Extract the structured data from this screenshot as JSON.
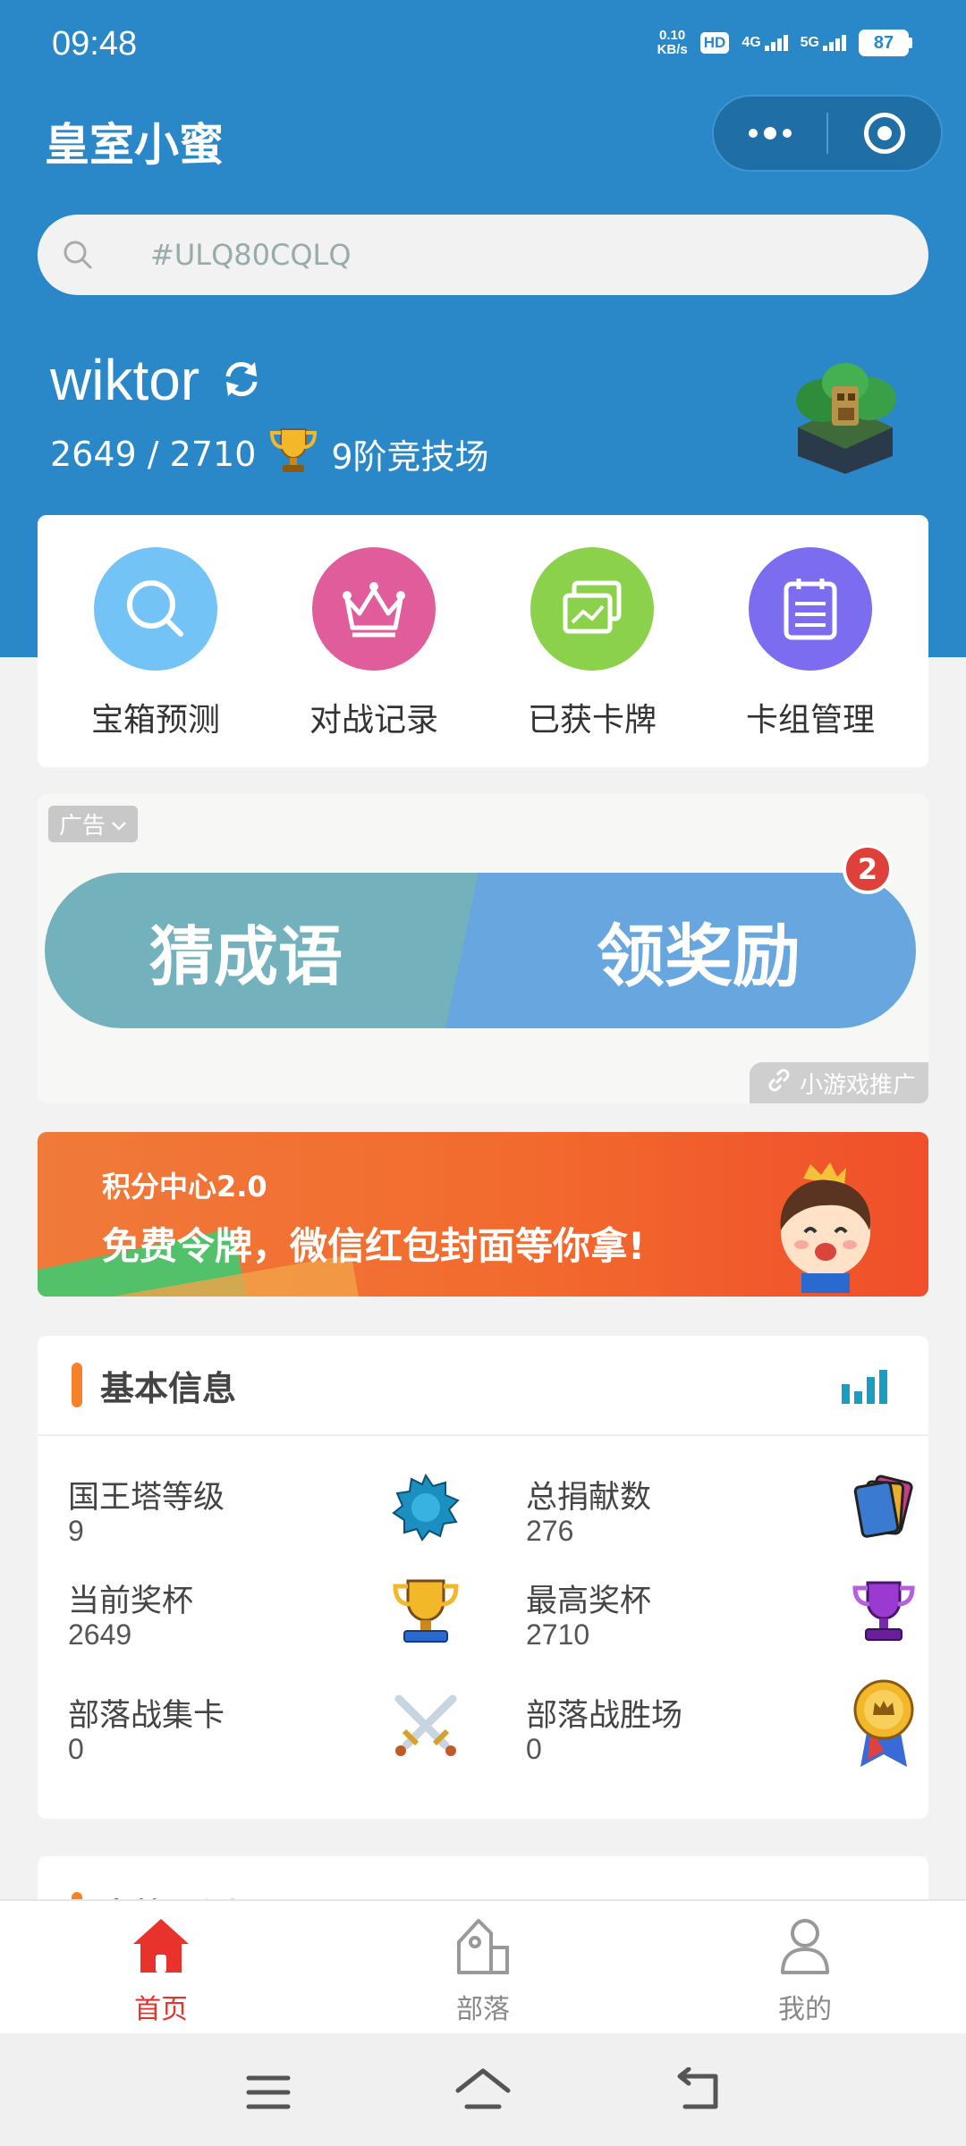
{
  "status_bar": {
    "time": "09:48",
    "speed_value": "0.10",
    "speed_unit": "KB/s",
    "hd_label": "HD",
    "net1_label": "4G",
    "net2_label": "5G",
    "battery": "87"
  },
  "header": {
    "title": "皇室小蜜"
  },
  "search": {
    "placeholder": "#ULQ80CQLQ"
  },
  "player": {
    "name": "wiktor",
    "trophies": "2649 / 2710",
    "arena": "9阶竞技场"
  },
  "quick_actions": [
    {
      "label": "宝箱预测",
      "color": "#73c3f6"
    },
    {
      "label": "对战记录",
      "color": "#e05c9a"
    },
    {
      "label": "已获卡牌",
      "color": "#8bd14c"
    },
    {
      "label": "卡组管理",
      "color": "#7b6cf0"
    }
  ],
  "ad": {
    "tag": "广告",
    "left_text": "猜成语",
    "right_text": "领奖励",
    "badge": "2",
    "promo": "小游戏推广"
  },
  "banner": {
    "title": "积分中心2.0",
    "subtitle": "免费令牌，微信红包封面等你拿!"
  },
  "basic_info": {
    "title": "基本信息",
    "stats": [
      {
        "label": "国王塔等级",
        "value": "9",
        "icon": "king-level-icon"
      },
      {
        "label": "总捐献数",
        "value": "276",
        "icon": "cards-icon"
      },
      {
        "label": "当前奖杯",
        "value": "2649",
        "icon": "gold-trophy-icon"
      },
      {
        "label": "最高奖杯",
        "value": "2710",
        "icon": "purple-trophy-icon"
      },
      {
        "label": "部落战集卡",
        "value": "0",
        "icon": "crossed-swords-icon"
      },
      {
        "label": "部落战胜场",
        "value": "0",
        "icon": "medal-icon"
      }
    ]
  },
  "next_section": {
    "title": "宝箱预测"
  },
  "tabbar": {
    "tabs": [
      {
        "label": "首页",
        "active": true
      },
      {
        "label": "部落",
        "active": false
      },
      {
        "label": "我的",
        "active": false
      }
    ]
  }
}
